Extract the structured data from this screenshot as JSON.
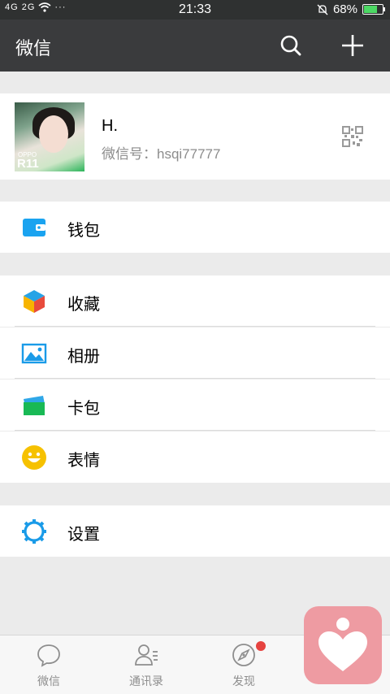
{
  "status_bar": {
    "left_label": "4G 2G",
    "time": "21:33",
    "battery_percent": "68%",
    "battery_level": 0.68
  },
  "header": {
    "title": "微信",
    "icons": [
      "search-icon",
      "plus-icon"
    ]
  },
  "profile": {
    "name": "H.",
    "wechat_id": "微信号：hsqi77777",
    "avatar_overlay": {
      "brand": "OPPO",
      "model": "R11"
    }
  },
  "menu": {
    "wallet": "钱包",
    "favorites": "收藏",
    "album": "相册",
    "cards": "卡包",
    "stickers": "表情",
    "settings": "设置"
  },
  "tabs": [
    {
      "label": "微信",
      "icon": "chat-icon"
    },
    {
      "label": "通讯录",
      "icon": "contacts-icon"
    },
    {
      "label": "发现",
      "icon": "compass-icon",
      "badge": true
    }
  ],
  "colors": {
    "titlebar": "#3a3b3d",
    "wallet": "#1aa3f0",
    "settings": "#1a9be8",
    "stickers": "#f6c100",
    "badge": "#e64340",
    "floating_app": "#ee9ba2"
  }
}
